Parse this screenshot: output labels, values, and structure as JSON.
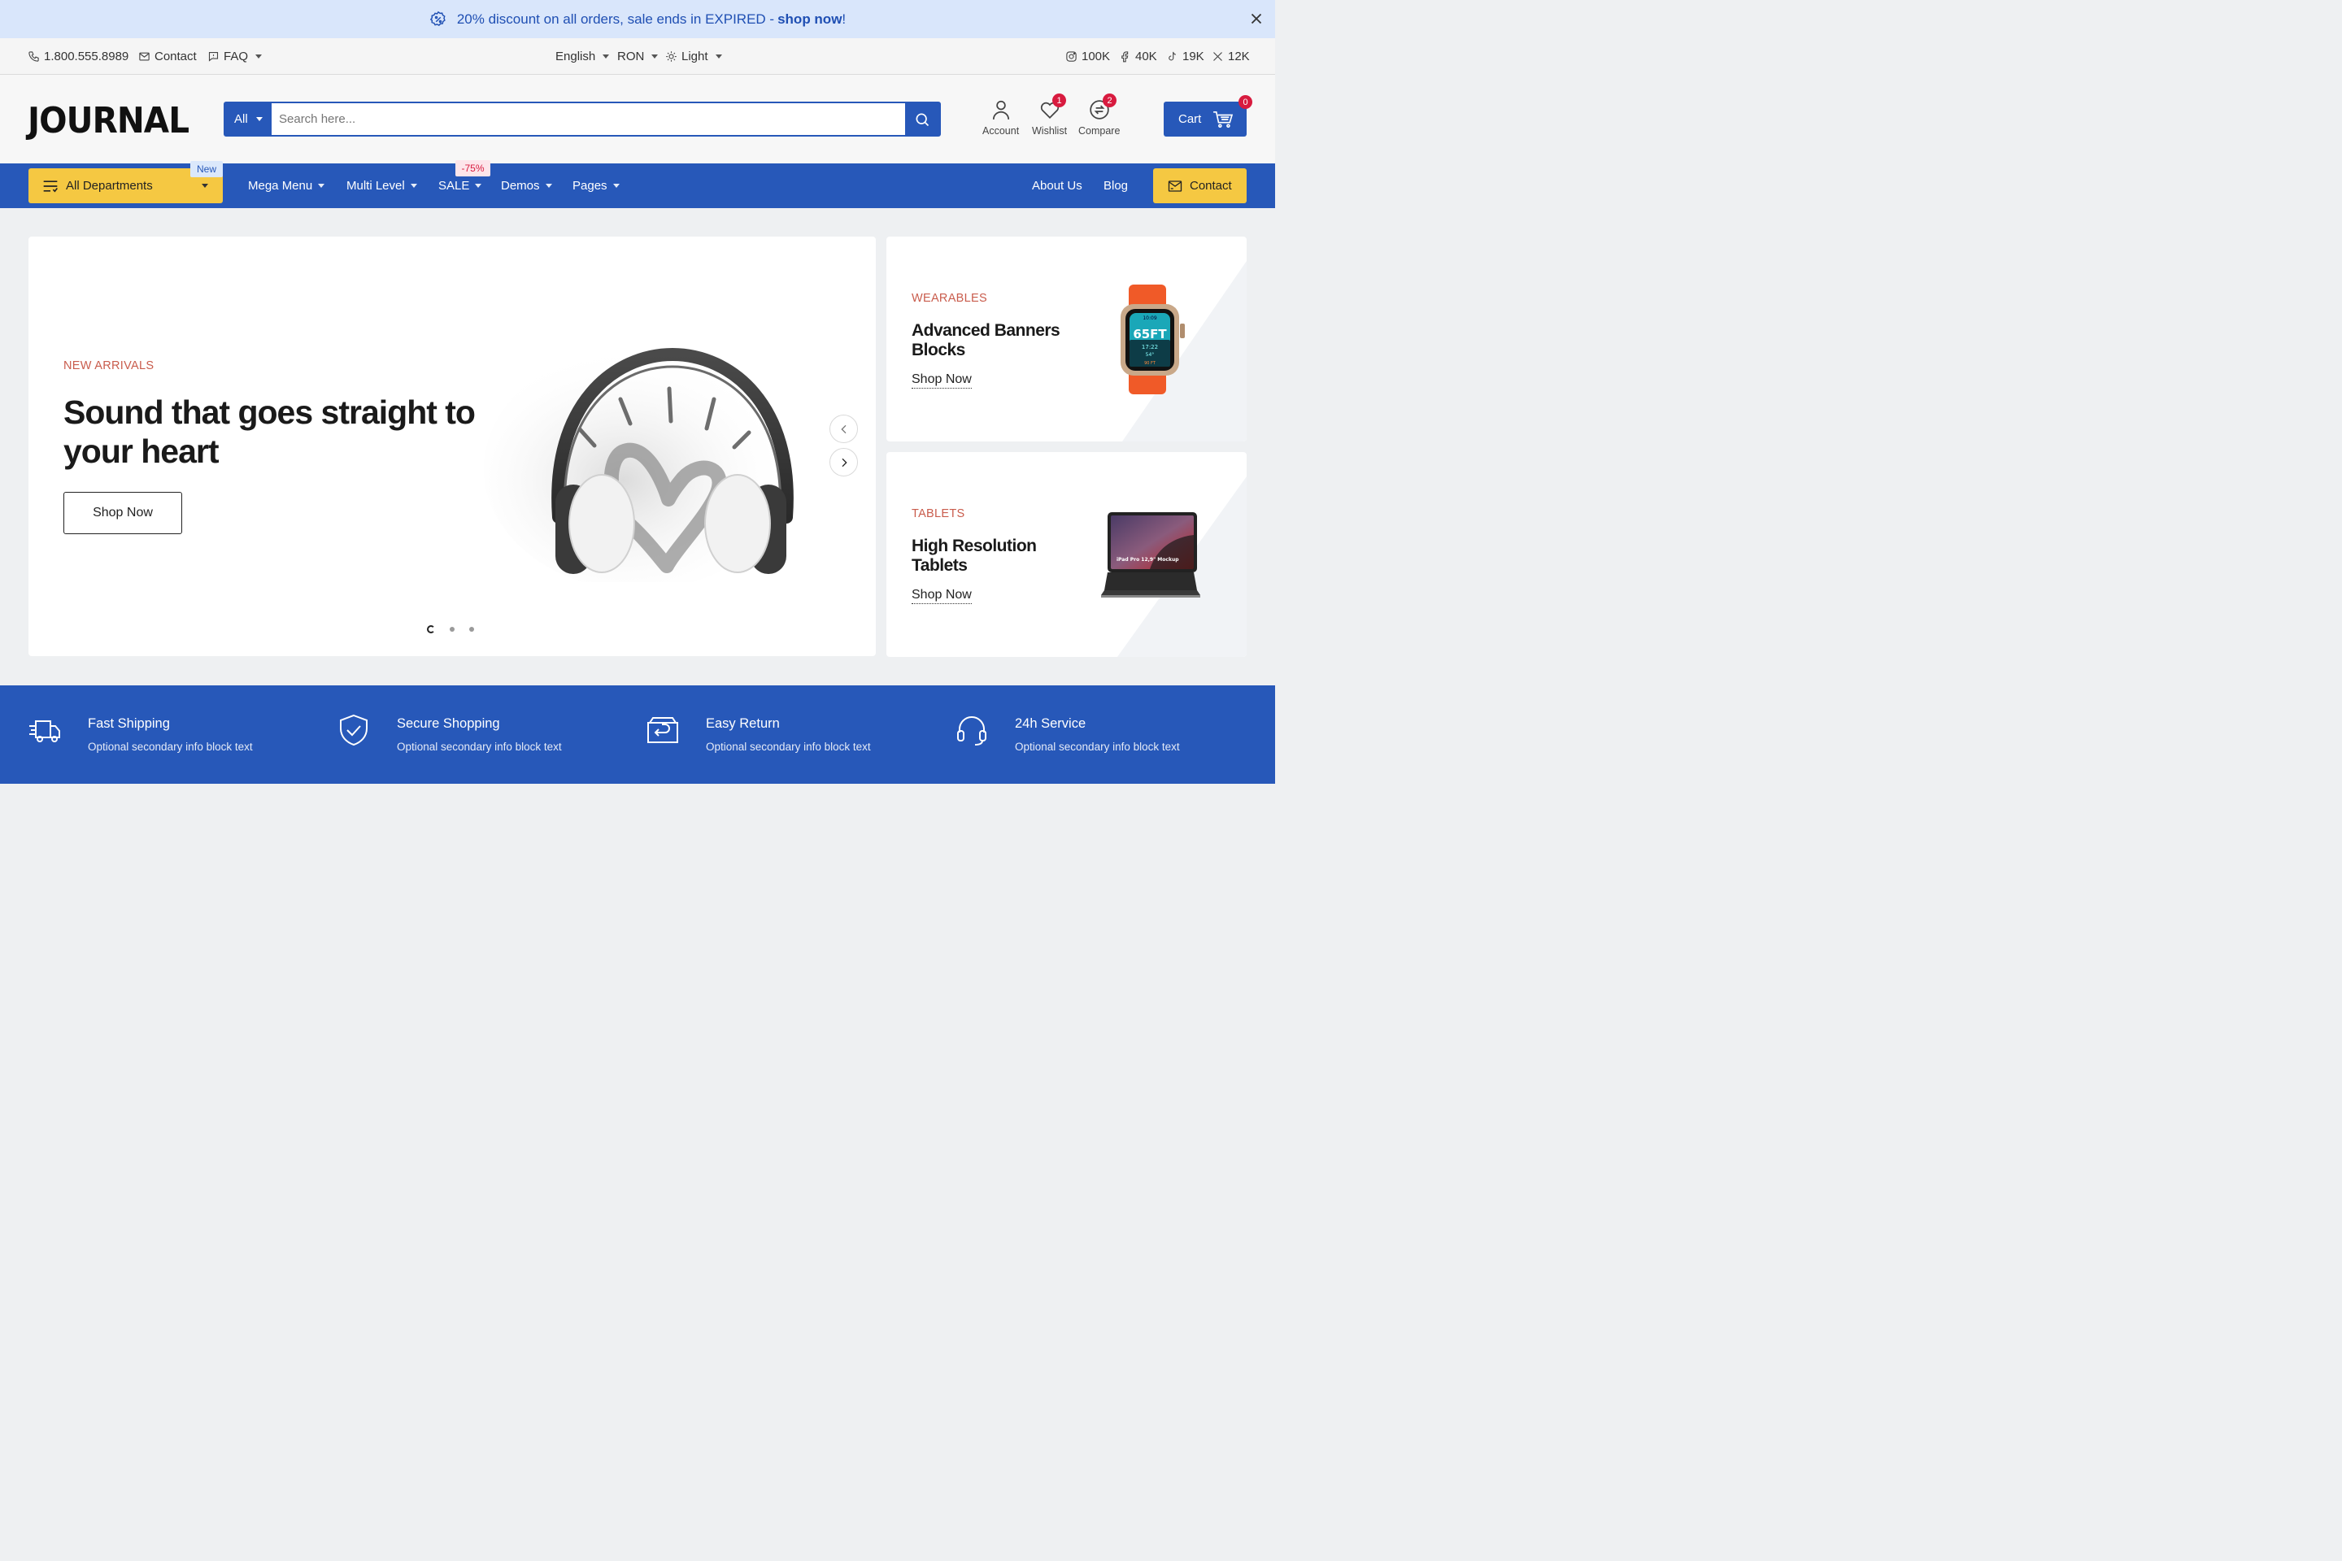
{
  "promo": {
    "text": "20% discount on all orders, sale ends in EXPIRED - ",
    "link": "shop now",
    "suffix": "!",
    "icon": "percent-badge-icon",
    "close_icon": "close-icon"
  },
  "topbar": {
    "phone": "1.800.555.8989",
    "contact": "Contact",
    "faq": "FAQ",
    "language": "English",
    "currency": "RON",
    "theme": "Light",
    "social": {
      "instagram": "100K",
      "facebook": "40K",
      "tiktok": "19K",
      "x": "12K"
    }
  },
  "header": {
    "logo": "JOURNAL",
    "search": {
      "category": "All",
      "placeholder": "Search here..."
    },
    "account": "Account",
    "wishlist": "Wishlist",
    "wishlist_count": "1",
    "compare": "Compare",
    "compare_count": "2",
    "cart": "Cart",
    "cart_count": "0"
  },
  "nav": {
    "departments": "All Departments",
    "new_tag": "New",
    "sale_tag": "-75%",
    "items": [
      "Mega Menu",
      "Multi Level",
      "SALE",
      "Demos",
      "Pages"
    ],
    "right_links": [
      "About Us",
      "Blog"
    ],
    "contact": "Contact"
  },
  "hero": {
    "eyebrow": "NEW ARRIVALS",
    "title": "Sound that goes straight to your heart",
    "button": "Shop Now",
    "slide_count": 3,
    "active_slide": 1
  },
  "banners": [
    {
      "eyebrow": "WEARABLES",
      "title": "Advanced Banners Blocks",
      "link": "Shop Now",
      "watch_face": {
        "big": "65FT",
        "time": "17:22",
        "top": "10:09",
        "deg": "54°",
        "bottom": "90 FT"
      }
    },
    {
      "eyebrow": "TABLETS",
      "title": "High Resolution Tablets",
      "link": "Shop Now",
      "screen_text": "iPad Pro 12,9\" Mockup"
    }
  ],
  "features": [
    {
      "title": "Fast Shipping",
      "subtitle": "Optional secondary info block text",
      "icon": "truck-icon"
    },
    {
      "title": "Secure Shopping",
      "subtitle": "Optional secondary info block text",
      "icon": "shield-check-icon"
    },
    {
      "title": "Easy Return",
      "subtitle": "Optional secondary info block text",
      "icon": "return-box-icon"
    },
    {
      "title": "24h Service",
      "subtitle": "Optional secondary info block text",
      "icon": "headset-icon"
    }
  ],
  "colors": {
    "brand_blue": "#2758b9",
    "accent_yellow": "#f5c842",
    "badge_red": "#d81b3f",
    "eyebrow": "#c95c4c",
    "promo_bg": "#d9e6fb"
  }
}
